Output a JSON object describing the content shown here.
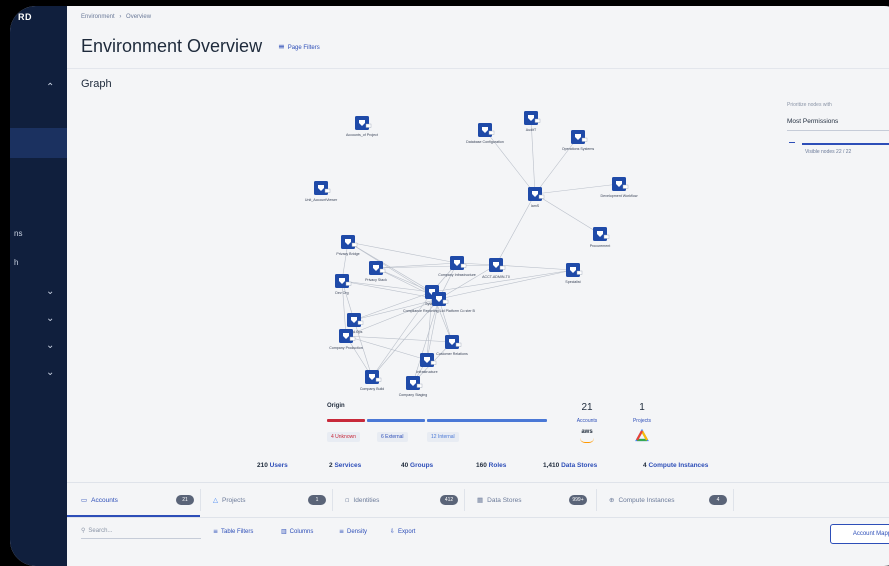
{
  "logo": "RD",
  "sidebar": {
    "partial_labels": [
      "ns",
      "h"
    ]
  },
  "breadcrumb": [
    "Environment",
    "›",
    "Overview"
  ],
  "page_title": "Environment Overview",
  "page_filters_label": "Page Filters",
  "graph_title": "Graph",
  "prioritize": {
    "label": "Prioritize nodes with",
    "value": "Most Permissions",
    "visible_nodes": "Visible nodes 22 / 22"
  },
  "nodes": [
    {
      "id": "n1",
      "label": "Accounts_of Project"
    },
    {
      "id": "n2",
      "label": "Database Configuration"
    },
    {
      "id": "n3",
      "label": "AuditT"
    },
    {
      "id": "n4",
      "label": "Operations Systems"
    },
    {
      "id": "n5",
      "label": "Unit_AccountViewer"
    },
    {
      "id": "n6",
      "label": "IamS"
    },
    {
      "id": "n7",
      "label": "Privacy Bridge"
    },
    {
      "id": "n8",
      "label": "Development Workflow"
    },
    {
      "id": "n9",
      "label": "Procurement"
    },
    {
      "id": "n10",
      "label": "Privacy Stack"
    },
    {
      "id": "n11",
      "label": "Company Infrastructure"
    },
    {
      "id": "n12",
      "label": "ACCT-ADMIN-T0"
    },
    {
      "id": "n13",
      "label": "Specialist"
    },
    {
      "id": "n14",
      "label": "Dev Org"
    },
    {
      "id": "n15",
      "label": "Systems"
    },
    {
      "id": "n16",
      "label": "Compliance Reporting Ltd Platform Co ster B"
    },
    {
      "id": "n17",
      "label": "Cloud Ops"
    },
    {
      "id": "n18",
      "label": "Company Production"
    },
    {
      "id": "n19",
      "label": "Customer Relations"
    },
    {
      "id": "n20",
      "label": "Infrastructure"
    },
    {
      "id": "n21",
      "label": "Company Build"
    },
    {
      "id": "n22",
      "label": "Company Staging"
    }
  ],
  "origin": {
    "label": "Origin",
    "bars": [
      {
        "color": "#c8293a",
        "share": 0.23
      },
      {
        "color": "#4a78d6",
        "share": 0.27
      },
      {
        "color": "#4a78d6",
        "share": 0.5
      }
    ],
    "tags": [
      {
        "text": "4 Unknown",
        "color": "#c8293a"
      },
      {
        "text": "6 External",
        "color": "#2d4eb8"
      },
      {
        "text": "12 Internal",
        "color": "#4a78d6"
      }
    ]
  },
  "stats": {
    "accounts": {
      "value": "21",
      "label": "Accounts",
      "logo": "aws"
    },
    "projects": {
      "value": "1",
      "label": "Projects"
    }
  },
  "summary": [
    {
      "num": "210",
      "label": "Users"
    },
    {
      "num": "2",
      "label": "Services"
    },
    {
      "num": "40",
      "label": "Groups"
    },
    {
      "num": "160",
      "label": "Roles"
    },
    {
      "num": "1,410",
      "label": "Data Stores"
    },
    {
      "num": "4",
      "label": "Compute Instances"
    }
  ],
  "tabs": [
    {
      "label": "Accounts",
      "badge": "21",
      "icon": "card-icon"
    },
    {
      "label": "Projects",
      "badge": "1",
      "icon": "gcp-icon"
    },
    {
      "label": "Identities",
      "badge": "412",
      "icon": "id-icon"
    },
    {
      "label": "Data Stores",
      "badge": "999+",
      "icon": "table-icon"
    },
    {
      "label": "Compute Instances",
      "badge": "4",
      "icon": "compute-icon"
    }
  ],
  "toolbar": {
    "search_placeholder": "Search...",
    "table_filters": "Table Filters",
    "columns": "Columns",
    "density": "Density",
    "export": "Export",
    "account_mapping": "Account Mapping"
  },
  "colors": {
    "sidebar": "#101f3d",
    "accent": "#2d4eb8",
    "node": "#1f4aa8"
  }
}
